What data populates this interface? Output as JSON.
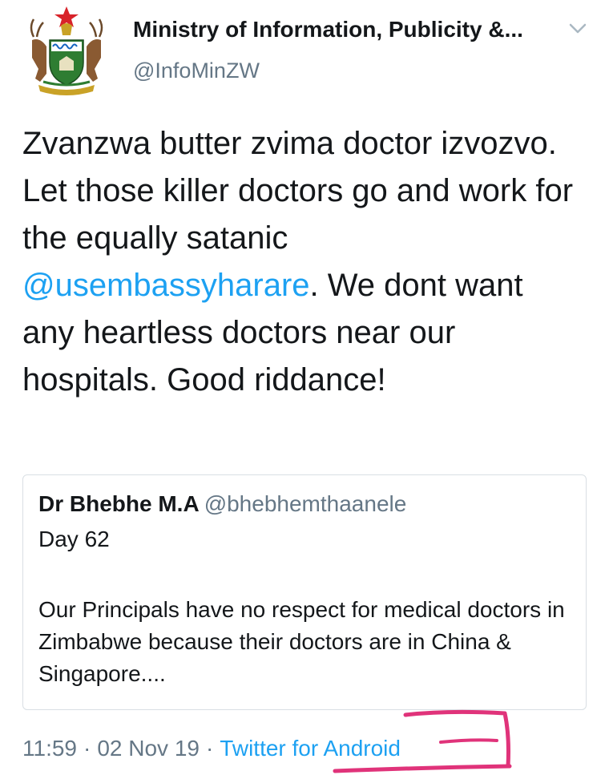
{
  "author": {
    "display_name": "Ministry of Information, Publicity &...",
    "handle": "@InfoMinZW",
    "avatar": "zimbabwe-coat-of-arms"
  },
  "tweet": {
    "text_before": "Zvanzwa butter zvima doctor izvozvo. Let those killer doctors go and work for the equally satanic ",
    "mention": "@usembassyharare",
    "text_after": ". We dont want any heartless doctors near our hospitals. Good riddance!"
  },
  "quoted_tweet": {
    "name": "Dr Bhebhe M.A",
    "handle": "@bhebhemthaanele",
    "line1": "Day 62",
    "body": "Our Principals have no respect for medical doctors in Zimbabwe because their doctors are in China & Singapore...."
  },
  "meta": {
    "time": "11:59",
    "separator": "·",
    "date": "02 Nov 19",
    "source": "Twitter for Android"
  },
  "icons": {
    "caret": "chevron-down-icon"
  },
  "colors": {
    "link": "#1da1f2",
    "secondary_text": "#657786",
    "annotation_marker": "#e0337a"
  }
}
